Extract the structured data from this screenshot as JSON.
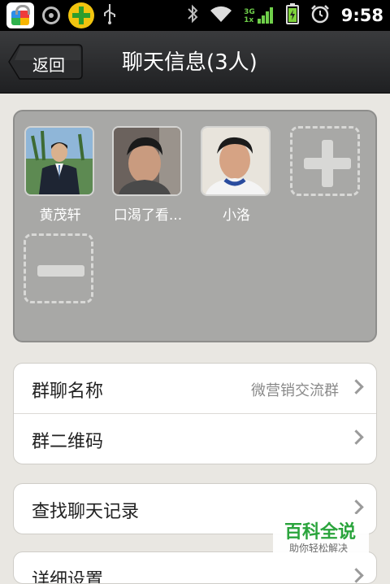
{
  "status_bar": {
    "time": "9:58",
    "icons": [
      "app-store-icon",
      "media-icon",
      "plus-360-icon",
      "usb-icon",
      "bluetooth-icon",
      "wifi-icon",
      "signal-3g-icon",
      "battery-icon",
      "alarm-icon"
    ],
    "network_label_top": "3G",
    "network_label_bottom": "1x"
  },
  "header": {
    "back_label": "返回",
    "title": "聊天信息(3人)"
  },
  "members": [
    {
      "name": "黄茂轩"
    },
    {
      "name": "口渴了看..."
    },
    {
      "name": "小洛"
    }
  ],
  "settings": {
    "group_name_label": "群聊名称",
    "group_name_value": "微营销交流群",
    "qr_label": "群二维码",
    "search_label": "查找聊天记录",
    "detail_label": "详细设置"
  },
  "watermark": {
    "main": "百科全说",
    "sub": "助你轻松解决"
  },
  "colors": {
    "title_bar": "#2b2c2e",
    "panel": "#a8a8a6",
    "background": "#e9e7e2",
    "watermark_green": "#2aa43c"
  }
}
